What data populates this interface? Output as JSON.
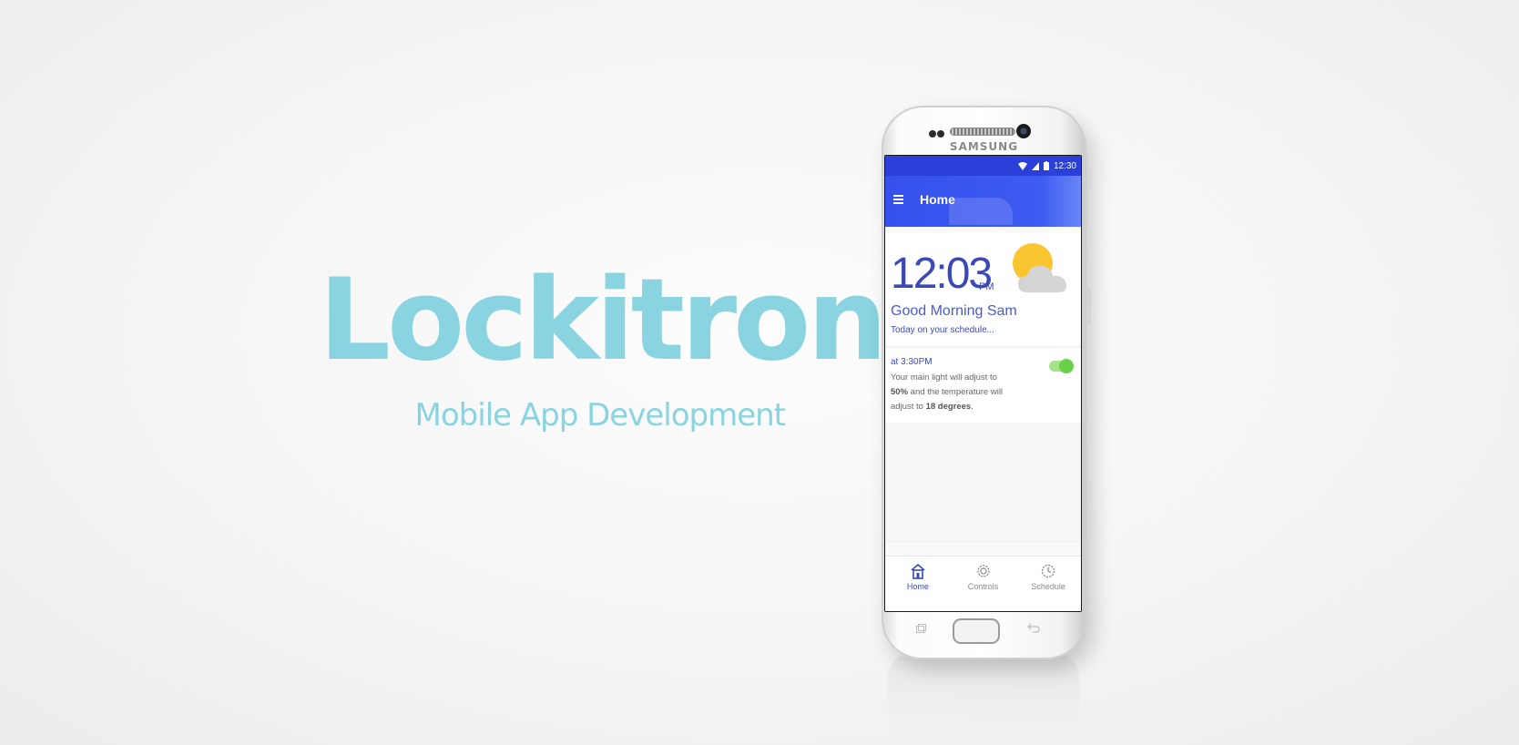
{
  "hero": {
    "title": "Lockitron",
    "subtitle": "Mobile App Development"
  },
  "device": {
    "brand": "SAMSUNG"
  },
  "status_bar": {
    "time": "12:30"
  },
  "app_bar": {
    "title": "Home",
    "menu_icon": "hamburger-menu-icon"
  },
  "home": {
    "clock_time": "12:03",
    "clock_ampm": "PM",
    "weather_icon": "partly-cloudy-icon",
    "greeting": "Good Morning Sam",
    "schedule_intro": "Today on your schedule..."
  },
  "schedule_item": {
    "time": "at 3:30PM",
    "text_part1": "Your main light will adjust to ",
    "bold_value1": "50%",
    "text_part2": " and the temperature will adjust to ",
    "bold_value2": "18 degrees",
    "text_end": ".",
    "toggle_on": true
  },
  "bottom_nav": {
    "items": [
      {
        "label": "Home",
        "icon": "home-icon",
        "active": true
      },
      {
        "label": "Controls",
        "icon": "gear-icon",
        "active": false
      },
      {
        "label": "Schedule",
        "icon": "clock-gear-icon",
        "active": false
      }
    ]
  },
  "colors": {
    "hero_text": "#89d4e0",
    "app_bar": "#3e5bf2",
    "status_bar": "#2a40d8",
    "clock_text": "#3a48b8",
    "toggle_on": "#6ad04a",
    "weather_sun": "#f9c531",
    "weather_cloud": "#d4d4d4"
  }
}
